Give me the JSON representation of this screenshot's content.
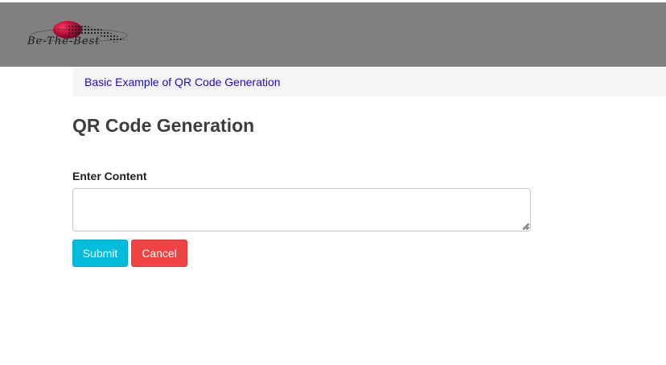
{
  "header": {
    "logo_text": "Be-The-Best",
    "background_color": "#808080"
  },
  "breadcrumb": {
    "link_label": "Basic Example of QR Code Generation"
  },
  "main": {
    "title": "QR Code Generation",
    "content_label": "Enter Content",
    "content_value": "",
    "submit_label": "Submit",
    "cancel_label": "Cancel"
  },
  "colors": {
    "submit": "#00bcdd",
    "cancel": "#f04444",
    "link": "#1a0dcc"
  }
}
